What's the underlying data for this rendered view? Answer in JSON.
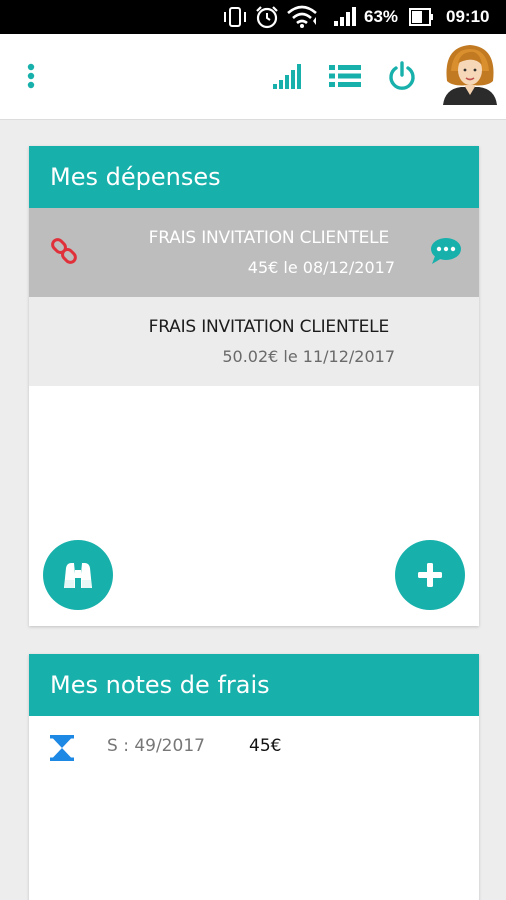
{
  "status_bar": {
    "battery_percent": "63%",
    "time": "09:10",
    "icons": [
      "vibrate-icon",
      "alarm-icon",
      "wifi-icon",
      "cell-signal-icon",
      "battery-icon"
    ]
  },
  "app_bar": {
    "icons": [
      "overflow-menu-icon",
      "signal-bars-icon",
      "list-icon",
      "power-icon",
      "avatar"
    ]
  },
  "expenses": {
    "title": "Mes dépenses",
    "items": [
      {
        "title": "FRAIS INVITATION CLIENTELE",
        "subtitle": "45€ le 08/12/2017",
        "selected": true,
        "linked": true,
        "has_comment": true
      },
      {
        "title": "FRAIS INVITATION CLIENTELE",
        "subtitle": "50.02€ le 11/12/2017",
        "selected": false,
        "linked": false,
        "has_comment": false
      }
    ],
    "actions": [
      "binoculars-icon",
      "plus-icon"
    ]
  },
  "notes": {
    "title": "Mes notes de frais",
    "items": [
      {
        "period": "S : 49/2017",
        "amount": "45€",
        "status_icon": "hourglass-icon"
      }
    ]
  },
  "colors": {
    "accent": "#17b0ab",
    "selected_row": "#bdbdbd",
    "plain_row": "#ececec",
    "link_icon": "#e0313b",
    "hourglass": "#1e88e5"
  }
}
